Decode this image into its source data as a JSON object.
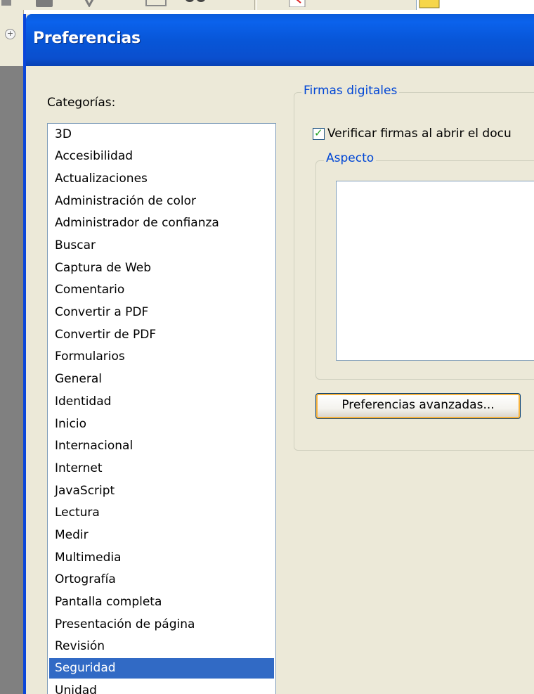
{
  "dialog": {
    "title": "Preferencias"
  },
  "categories": {
    "label": "Categorías:",
    "items": [
      "3D",
      "Accesibilidad",
      "Actualizaciones",
      "Administración de color",
      "Administrador de confianza",
      "Buscar",
      "Captura de Web",
      "Comentario",
      "Convertir a PDF",
      "Convertir de PDF",
      "Formularios",
      "General",
      "Identidad",
      "Inicio",
      "Internacional",
      "Internet",
      "JavaScript",
      "Lectura",
      "Medir",
      "Multimedia",
      "Ortografía",
      "Pantalla completa",
      "Presentación de página",
      "Revisión",
      "Seguridad",
      "Unidad"
    ],
    "selected": "Seguridad"
  },
  "firmas": {
    "legend": "Firmas digitales",
    "verify_label": "Verificar firmas al abrir el docu",
    "verify_checked": true,
    "aspecto_legend": "Aspecto",
    "advanced_button": "Preferencias avanzadas..."
  },
  "colors": {
    "titlebar": "#0856d8",
    "selection": "#316ac5",
    "legend_text": "#0046d5",
    "dialog_bg": "#ece9d8"
  },
  "icons": {
    "expand": "expand-plus-icon",
    "check": "checkmark-icon"
  }
}
